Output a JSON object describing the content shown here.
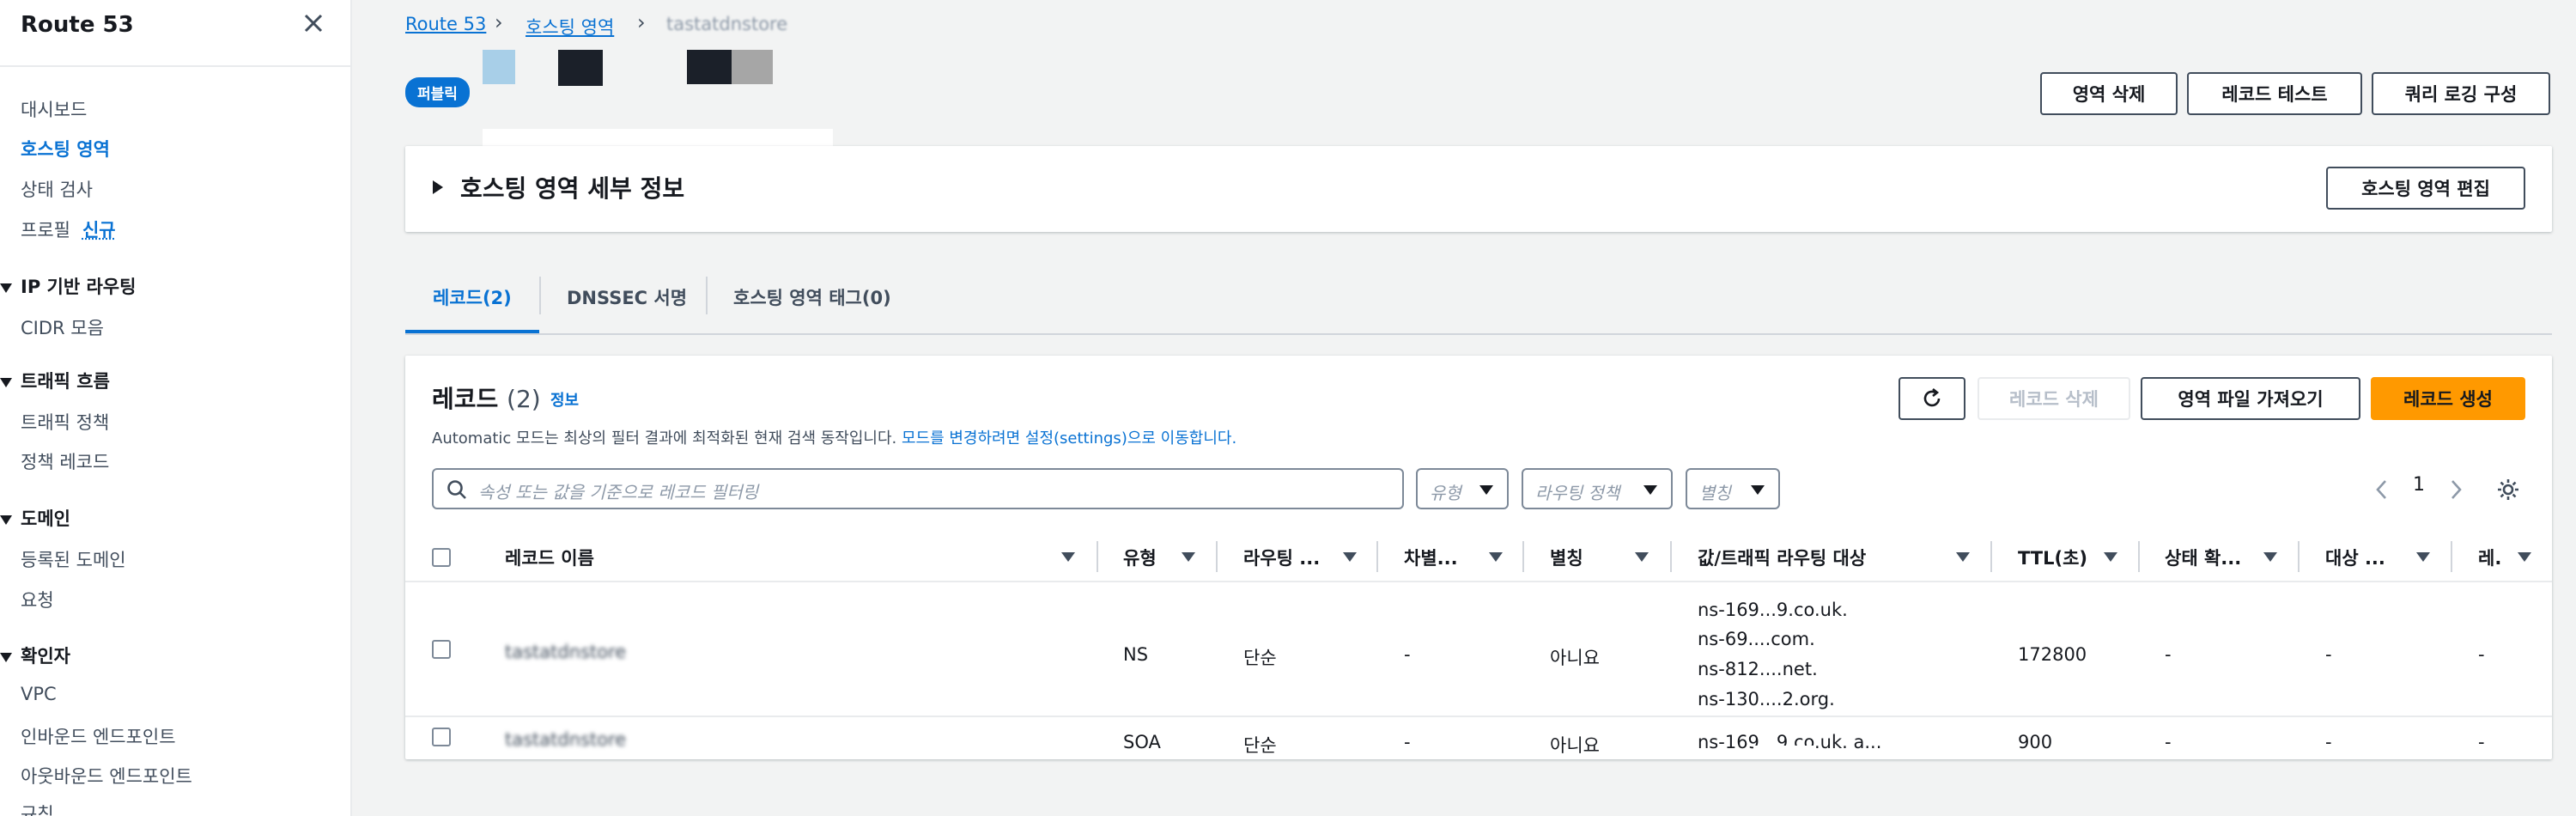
{
  "sidebar": {
    "title": "Route 53",
    "items": {
      "dashboard": "대시보드",
      "hosted_zones": "호스팅 영역",
      "health_checks": "상태 검사",
      "profiles": "프로필",
      "profiles_new": "신규",
      "cidr": "CIDR 모음",
      "traffic_policies": "트래픽 정책",
      "policy_records": "정책 레코드",
      "registered_domains": "등록된 도메인",
      "requests": "요청",
      "vpc": "VPC",
      "inbound_endpoints": "인바운드 엔드포인트",
      "outbound_endpoints": "아웃바운드 엔드포인트",
      "rules": "규칙"
    },
    "sections": {
      "ip_routing": "IP 기반 라우팅",
      "traffic_flow": "트래픽 흐름",
      "domains": "도메인",
      "resolver": "확인자"
    }
  },
  "breadcrumb": {
    "root": "Route 53",
    "hosted_zones": "호스팅 영역",
    "current": "tastatdnstore"
  },
  "zone": {
    "badge": "퍼블릭"
  },
  "header_buttons": {
    "delete_zone": "영역 삭제",
    "test_record": "레코드 테스트",
    "query_logging": "쿼리 로깅 구성"
  },
  "details": {
    "title": "호스팅 영역 세부 정보",
    "edit_button": "호스팅 영역 편집"
  },
  "tabs": {
    "records": "레코드(2)",
    "dnssec": "DNSSEC 서명",
    "tags": "호스팅 영역 태그(0)"
  },
  "records": {
    "title": "레코드",
    "count": "(2)",
    "info": "정보",
    "desc": "Automatic 모드는 최상의 필터 결과에 최적화된 현재 검색 동작입니다. ",
    "desc_link": "모드를 변경하려면 설정(settings)으로 이동합니다.",
    "delete_button": "레코드 삭제",
    "import_button": "영역 파일 가져오기",
    "create_button": "레코드 생성",
    "search_placeholder": "속성 또는 값을 기준으로 레코드 필터링",
    "filter_type": "유형",
    "filter_routing": "라우팅 정책",
    "filter_alias": "별칭",
    "page": "1"
  },
  "table": {
    "headers": {
      "name": "레코드 이름",
      "type": "유형",
      "routing": "라우팅 ...",
      "differentiator": "차별...",
      "alias": "별칭",
      "value": "값/트래픽 라우팅 대상",
      "ttl": "TTL(초)",
      "health": "상태 확...",
      "target": "대상 ...",
      "record_id": "레."
    },
    "rows": [
      {
        "name": "tastatdnstore",
        "type": "NS",
        "routing": "단순",
        "differentiator": "-",
        "alias": "아니요",
        "value_lines": [
          "ns-169...9.co.uk.",
          "ns-69....com.",
          "ns-812....net.",
          "ns-130....2.org."
        ],
        "ttl": "172800",
        "health": "-",
        "target": "-",
        "record_id": "-"
      },
      {
        "name": "tastatdnstore",
        "type": "SOA",
        "routing": "단순",
        "differentiator": "-",
        "alias": "아니요",
        "value": "ns-169...9.co.uk. a...",
        "ttl": "900",
        "health": "-",
        "target": "-",
        "record_id": "-"
      }
    ]
  }
}
